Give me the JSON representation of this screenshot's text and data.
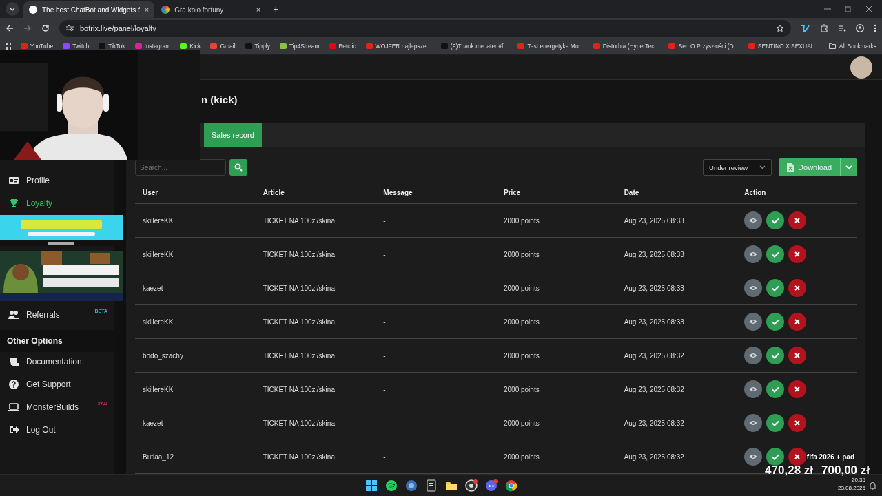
{
  "browser": {
    "tabs": [
      {
        "title": "The best ChatBot and Widgets f",
        "close": "×",
        "selected": true
      },
      {
        "title": "Gra koło fortuny",
        "close": "×",
        "selected": false
      }
    ],
    "new_tab": "+",
    "url": "botrix.live/panel/loyalty",
    "bookmarks": [
      {
        "label": "YouTube",
        "color": "#e62117"
      },
      {
        "label": "Twitch",
        "color": "#9146ff"
      },
      {
        "label": "TikTok",
        "color": "#111111"
      },
      {
        "label": "Instagram",
        "color": "#d6249f"
      },
      {
        "label": "Kick",
        "color": "#53fc18"
      },
      {
        "label": "Gmail",
        "color": "#ea4335"
      },
      {
        "label": "Tipply",
        "color": "#111111"
      },
      {
        "label": "Tip4Stream",
        "color": "#8bc34a"
      },
      {
        "label": "Betclic",
        "color": "#e30613"
      },
      {
        "label": "WOJFER najlepsze...",
        "color": "#e62117"
      },
      {
        "label": "(9)Thank me later #f...",
        "color": "#111111"
      },
      {
        "label": "Test energetyka Mo...",
        "color": "#e62117"
      },
      {
        "label": "Disturbia (HyperTec...",
        "color": "#e62117"
      },
      {
        "label": "Sen O Przyszłości (D...",
        "color": "#e62117"
      },
      {
        "label": "SENTINO X SEXUAL...",
        "color": "#e62117"
      }
    ],
    "all_bookmarks": "All Bookmarks"
  },
  "sidebar": {
    "items": [
      {
        "label": "Profile",
        "selected": false
      },
      {
        "label": "Loyalty",
        "selected": true
      }
    ],
    "items_2": [
      {
        "label": "Referrals",
        "selected": false,
        "badge": "BETA",
        "color": "#2bb5c5"
      }
    ],
    "section": "Other Options",
    "other_items": [
      {
        "label": "Documentation"
      },
      {
        "label": "Get Support"
      },
      {
        "label": "MonsterBuilds",
        "badge": "#AD",
        "color": "#d63384"
      },
      {
        "label": "Log Out"
      }
    ]
  },
  "page": {
    "title": "n (kick)",
    "tabs": [
      {
        "label": "Sales record",
        "selected": true
      }
    ],
    "search": {
      "placeholder": "Search..."
    },
    "filter": "Under review",
    "download": "Download",
    "table": {
      "columns": [
        "User",
        "Article",
        "Message",
        "Price",
        "Date",
        "Action"
      ],
      "rows": [
        [
          "skillereKK",
          "TICKET NA 100zl/skina",
          "-",
          "2000 points",
          "Aug 23, 2025 08:33"
        ],
        [
          "skillereKK",
          "TICKET NA 100zl/skina",
          "-",
          "2000 points",
          "Aug 23, 2025 08:33"
        ],
        [
          "kaezet",
          "TICKET NA 100zl/skina",
          "-",
          "2000 points",
          "Aug 23, 2025 08:33"
        ],
        [
          "skillereKK",
          "TICKET NA 100zl/skina",
          "-",
          "2000 points",
          "Aug 23, 2025 08:33"
        ],
        [
          "bodo_szachy",
          "TICKET NA 100zl/skina",
          "-",
          "2000 points",
          "Aug 23, 2025 08:32"
        ],
        [
          "skillereKK",
          "TICKET NA 100zl/skina",
          "-",
          "2000 points",
          "Aug 23, 2025 08:32"
        ],
        [
          "kaezet",
          "TICKET NA 100zl/skina",
          "-",
          "2000 points",
          "Aug 23, 2025 08:32"
        ],
        [
          "Butlaa_12",
          "TICKET NA 100zl/skina",
          "-",
          "2000 points",
          "Aug 23, 2025 08:32"
        ]
      ]
    }
  },
  "overlay": {
    "goal_title": "fifa 2026 + pad",
    "current": "470,28 zł",
    "target": "700,00 zł"
  },
  "taskbar": {
    "time": "20:35",
    "date": "23.08.2025"
  }
}
